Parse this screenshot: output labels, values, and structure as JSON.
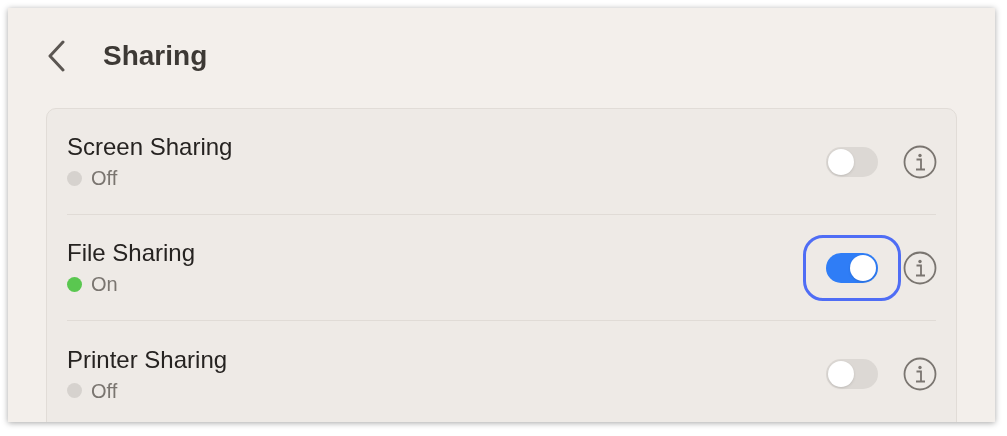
{
  "header": {
    "title": "Sharing"
  },
  "services": [
    {
      "name": "Screen Sharing",
      "status": "Off",
      "on": false,
      "focused": false
    },
    {
      "name": "File Sharing",
      "status": "On",
      "on": true,
      "focused": true
    },
    {
      "name": "Printer Sharing",
      "status": "Off",
      "on": false,
      "focused": false
    }
  ]
}
